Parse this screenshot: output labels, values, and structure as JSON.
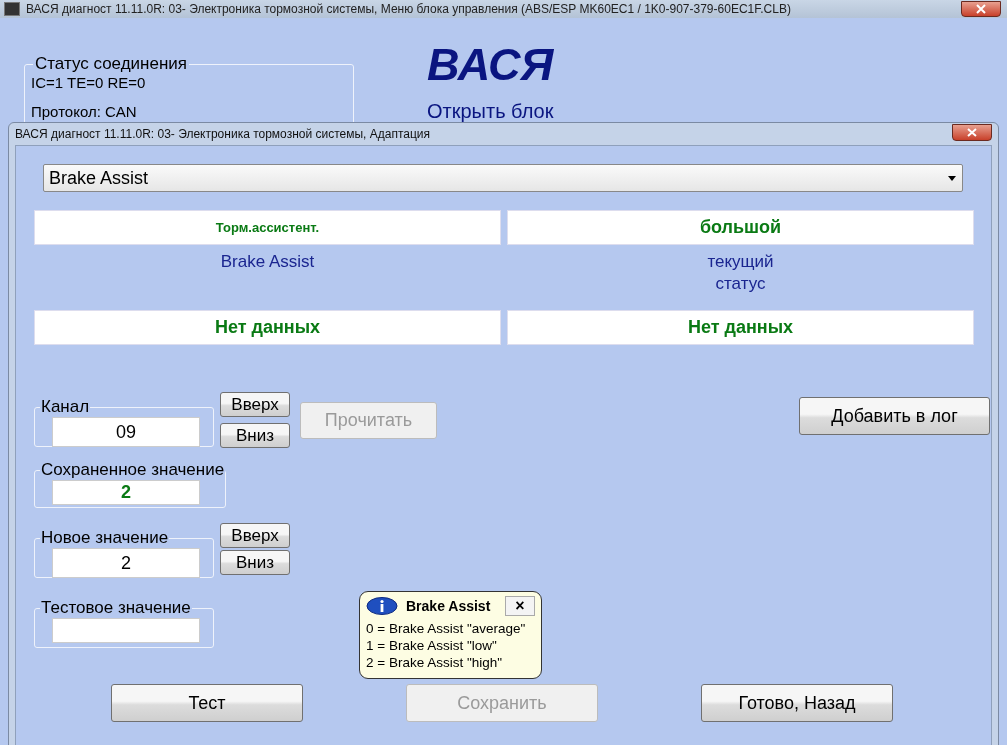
{
  "main_window": {
    "title": "ВАСЯ диагност 11.11.0R: 03- Электроника тормозной системы,  Меню блока управления (ABS/ESP MK60EC1 / 1K0-907-379-60EC1F.CLB)",
    "connection_status": {
      "title": "Статус соединения",
      "counters": "IC=1  TE=0   RE=0",
      "protocol": "Протокол: CAN"
    },
    "brand": "ВАСЯ",
    "open_unit_link": "Открыть блок"
  },
  "dialog": {
    "title": "ВАСЯ диагност 11.11.0R: 03- Электроника тормозной системы, Адаптация",
    "channel_select": {
      "value": "Brake Assist"
    },
    "value_rows": [
      {
        "left": {
          "kind": "small",
          "text": "Торм.ассистент."
        },
        "right": {
          "kind": "large",
          "text": "большой"
        }
      },
      {
        "left": {
          "kind": "label",
          "text": "Brake Assist"
        },
        "right": {
          "kind": "label",
          "text": "текущий\nстатус"
        }
      },
      {
        "left": {
          "kind": "large",
          "text": "Нет данных"
        },
        "right": {
          "kind": "large",
          "text": "Нет данных"
        }
      }
    ],
    "channel": {
      "label": "Канал",
      "value": "09",
      "up": "Вверх",
      "down": "Вниз"
    },
    "read_button": {
      "label": "Прочитать",
      "disabled": true
    },
    "add_log_button": {
      "label": "Добавить в лог",
      "disabled": false
    },
    "stored_value": {
      "label": "Сохраненное значение",
      "value": "2"
    },
    "new_value": {
      "label": "Новое значение",
      "value": "2",
      "up": "Вверх",
      "down": "Вниз"
    },
    "test_value": {
      "label": "Тестовое значение"
    },
    "bottom_buttons": [
      {
        "label": "Тест",
        "disabled": false
      },
      {
        "label": "Сохранить",
        "disabled": true
      },
      {
        "label": "Готово, Назад",
        "disabled": false
      }
    ],
    "tooltip": {
      "title": "Brake Assist",
      "close": "×",
      "lines": [
        "0 = Brake Assist \"average\"",
        "1 = Brake Assist \"low\"",
        "2 = Brake Assist \"high\""
      ]
    }
  }
}
